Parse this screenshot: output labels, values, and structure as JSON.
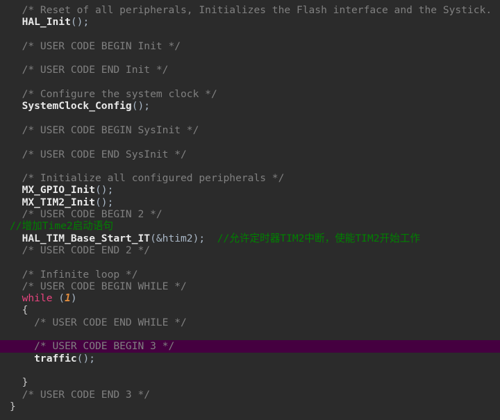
{
  "editor": {
    "name": "code-editor",
    "language": "C",
    "theme": "dark",
    "background_color": "#2b2b2b",
    "highlight_color": "#450040",
    "colors": {
      "block_comment": "#808080",
      "line_comment_green": "#008000",
      "function_name": "#e8e8e8",
      "keyword": "#e8447f",
      "number": "#e08b3c",
      "punctuation": "#a9b7c6"
    }
  },
  "lines": [
    {
      "id": "line-1",
      "highlighted": false,
      "tokens": [
        {
          "cls": "tok-comment",
          "text": "  /* Reset of all peripherals, Initializes the Flash interface and the Systick. "
        }
      ]
    },
    {
      "id": "line-2",
      "highlighted": false,
      "tokens": [
        {
          "cls": "tok-fn",
          "text": "  HAL_Init"
        },
        {
          "cls": "tok-punct",
          "text": "();"
        }
      ]
    },
    {
      "id": "line-3",
      "highlighted": false,
      "tokens": [
        {
          "cls": "tok-plain",
          "text": ""
        }
      ]
    },
    {
      "id": "line-4",
      "highlighted": false,
      "tokens": [
        {
          "cls": "tok-comment",
          "text": "  /* USER CODE BEGIN Init */"
        }
      ]
    },
    {
      "id": "line-5",
      "highlighted": false,
      "tokens": [
        {
          "cls": "tok-plain",
          "text": ""
        }
      ]
    },
    {
      "id": "line-6",
      "highlighted": false,
      "tokens": [
        {
          "cls": "tok-comment",
          "text": "  /* USER CODE END Init */"
        }
      ]
    },
    {
      "id": "line-7",
      "highlighted": false,
      "tokens": [
        {
          "cls": "tok-plain",
          "text": ""
        }
      ]
    },
    {
      "id": "line-8",
      "highlighted": false,
      "tokens": [
        {
          "cls": "tok-comment",
          "text": "  /* Configure the system clock */"
        }
      ]
    },
    {
      "id": "line-9",
      "highlighted": false,
      "tokens": [
        {
          "cls": "tok-fn",
          "text": "  SystemClock_Config"
        },
        {
          "cls": "tok-punct",
          "text": "();"
        }
      ]
    },
    {
      "id": "line-10",
      "highlighted": false,
      "tokens": [
        {
          "cls": "tok-plain",
          "text": ""
        }
      ]
    },
    {
      "id": "line-11",
      "highlighted": false,
      "tokens": [
        {
          "cls": "tok-comment",
          "text": "  /* USER CODE BEGIN SysInit */"
        }
      ]
    },
    {
      "id": "line-12",
      "highlighted": false,
      "tokens": [
        {
          "cls": "tok-plain",
          "text": ""
        }
      ]
    },
    {
      "id": "line-13",
      "highlighted": false,
      "tokens": [
        {
          "cls": "tok-comment",
          "text": "  /* USER CODE END SysInit */"
        }
      ]
    },
    {
      "id": "line-14",
      "highlighted": false,
      "tokens": [
        {
          "cls": "tok-plain",
          "text": ""
        }
      ]
    },
    {
      "id": "line-15",
      "highlighted": false,
      "tokens": [
        {
          "cls": "tok-comment",
          "text": "  /* Initialize all configured peripherals */"
        }
      ]
    },
    {
      "id": "line-16",
      "highlighted": false,
      "tokens": [
        {
          "cls": "tok-fn",
          "text": "  MX_GPIO_Init"
        },
        {
          "cls": "tok-punct",
          "text": "();"
        }
      ]
    },
    {
      "id": "line-17",
      "highlighted": false,
      "tokens": [
        {
          "cls": "tok-fn",
          "text": "  MX_TIM2_Init"
        },
        {
          "cls": "tok-punct",
          "text": "();"
        }
      ]
    },
    {
      "id": "line-18",
      "highlighted": false,
      "tokens": [
        {
          "cls": "tok-comment",
          "text": "  /* USER CODE BEGIN 2 */"
        }
      ]
    },
    {
      "id": "line-19",
      "highlighted": false,
      "tokens": [
        {
          "cls": "tok-linecmt",
          "text": "//增加Time2启动语句"
        }
      ]
    },
    {
      "id": "line-20",
      "highlighted": false,
      "tokens": [
        {
          "cls": "tok-fn",
          "text": "  HAL_TIM_Base_Start_IT"
        },
        {
          "cls": "tok-punct",
          "text": "(&htim2);"
        },
        {
          "cls": "tok-linecmt",
          "text": "  //允许定时器TIM2中断，使能TIM2开始工作"
        }
      ]
    },
    {
      "id": "line-21",
      "highlighted": false,
      "tokens": [
        {
          "cls": "tok-comment",
          "text": "  /* USER CODE END 2 */"
        }
      ]
    },
    {
      "id": "line-22",
      "highlighted": false,
      "tokens": [
        {
          "cls": "tok-plain",
          "text": ""
        }
      ]
    },
    {
      "id": "line-23",
      "highlighted": false,
      "tokens": [
        {
          "cls": "tok-comment",
          "text": "  /* Infinite loop */"
        }
      ]
    },
    {
      "id": "line-24",
      "highlighted": false,
      "tokens": [
        {
          "cls": "tok-comment",
          "text": "  /* USER CODE BEGIN WHILE */"
        }
      ]
    },
    {
      "id": "line-25",
      "highlighted": false,
      "tokens": [
        {
          "cls": "tok-keyword",
          "text": "  while"
        },
        {
          "cls": "tok-punct",
          "text": " ("
        },
        {
          "cls": "tok-number",
          "text": "1"
        },
        {
          "cls": "tok-punct",
          "text": ")"
        }
      ]
    },
    {
      "id": "line-26",
      "highlighted": false,
      "tokens": [
        {
          "cls": "tok-brace",
          "text": "  {"
        }
      ]
    },
    {
      "id": "line-27",
      "highlighted": false,
      "tokens": [
        {
          "cls": "tok-comment",
          "text": "    /* USER CODE END WHILE */"
        }
      ]
    },
    {
      "id": "line-28",
      "highlighted": false,
      "tokens": [
        {
          "cls": "tok-plain",
          "text": ""
        }
      ]
    },
    {
      "id": "line-29",
      "highlighted": true,
      "tokens": [
        {
          "cls": "tok-comment",
          "text": "    /* USER CODE BEGIN 3 */"
        }
      ]
    },
    {
      "id": "line-30",
      "highlighted": false,
      "tokens": [
        {
          "cls": "tok-fn",
          "text": "    traffic"
        },
        {
          "cls": "tok-punct",
          "text": "();"
        }
      ]
    },
    {
      "id": "line-31",
      "highlighted": false,
      "tokens": [
        {
          "cls": "tok-plain",
          "text": ""
        }
      ]
    },
    {
      "id": "line-32",
      "highlighted": false,
      "tokens": [
        {
          "cls": "tok-brace",
          "text": "  }"
        }
      ]
    },
    {
      "id": "line-33",
      "highlighted": false,
      "tokens": [
        {
          "cls": "tok-comment",
          "text": "  /* USER CODE END 3 */"
        }
      ]
    },
    {
      "id": "line-34",
      "highlighted": false,
      "tokens": [
        {
          "cls": "tok-brace",
          "text": "}"
        }
      ]
    }
  ]
}
